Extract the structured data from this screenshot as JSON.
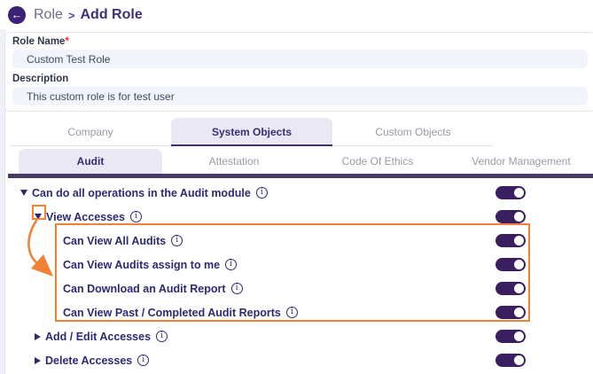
{
  "colors": {
    "accent_purple": "#3d2177",
    "toggle_purple": "#3b1e5f",
    "row_text": "#2c2a75",
    "tab_bar_purple": "#4b3a67",
    "highlight_orange": "#f08236",
    "required_red": "#e5322d"
  },
  "header": {
    "breadcrumb": {
      "parent": "Role",
      "separator": ">",
      "current": "Add Role"
    }
  },
  "form": {
    "fields": [
      {
        "label": "Role Name",
        "required": "*",
        "value": "Custom Test Role"
      },
      {
        "label": "Description",
        "required": "",
        "value": "This custom role is for test user"
      }
    ]
  },
  "tabs_primary": {
    "items": [
      {
        "label": "Company",
        "active": false
      },
      {
        "label": "System Objects",
        "active": true
      },
      {
        "label": "Custom Objects",
        "active": false
      }
    ]
  },
  "tabs_secondary": {
    "items": [
      {
        "label": "Audit",
        "active": true
      },
      {
        "label": "Attestation",
        "active": false
      },
      {
        "label": "Code Of Ethics",
        "active": false
      },
      {
        "label": "Vendor Management",
        "active": false
      }
    ]
  },
  "permissions": {
    "rows": [
      {
        "label": "Can do all operations in the Audit module",
        "level": 0,
        "expander": "expanded",
        "toggle": "on"
      },
      {
        "label": "View Accesses",
        "level": 1,
        "expander": "expanded",
        "toggle": "on",
        "annotation": "expander-highlighted"
      },
      {
        "label": "Can View All Audits",
        "level": 2,
        "expander": "none",
        "toggle": "on",
        "annotation": "inside-highlight-box"
      },
      {
        "label": "Can View Audits assign to me",
        "level": 2,
        "expander": "none",
        "toggle": "on",
        "annotation": "inside-highlight-box"
      },
      {
        "label": "Can Download an Audit Report",
        "level": 2,
        "expander": "none",
        "toggle": "on",
        "annotation": "inside-highlight-box"
      },
      {
        "label": "Can View Past / Completed Audit Reports",
        "level": 2,
        "expander": "none",
        "toggle": "on",
        "annotation": "inside-highlight-box"
      },
      {
        "label": "Add / Edit Accesses",
        "level": 1,
        "expander": "collapsed",
        "toggle": "on"
      },
      {
        "label": "Delete Accesses",
        "level": 1,
        "expander": "collapsed",
        "toggle": "on"
      }
    ]
  }
}
